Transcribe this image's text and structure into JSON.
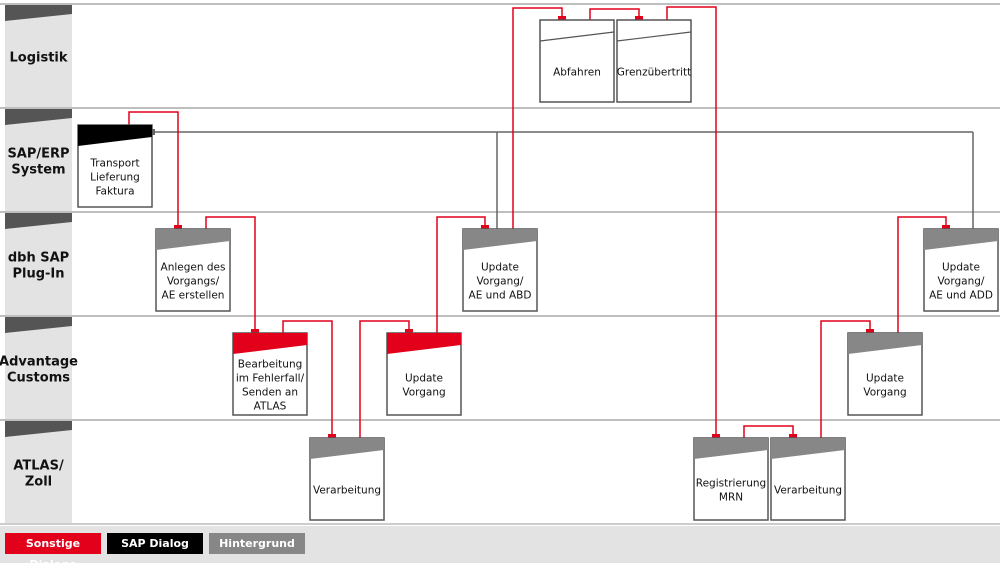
{
  "colors": {
    "red": "#e2001a",
    "black": "#000000",
    "gray": "#878787",
    "lane_bg": "#e3e3e3",
    "lane_strip": "#555555",
    "connector_gray": "#666666"
  },
  "lanes": [
    {
      "label": [
        "Logistik"
      ]
    },
    {
      "label": [
        "SAP/ERP",
        "System"
      ]
    },
    {
      "label": [
        "dbh SAP",
        "Plug-In"
      ]
    },
    {
      "label": [
        "Advantage",
        "Customs"
      ]
    },
    {
      "label": [
        "ATLAS/",
        "Zoll"
      ]
    }
  ],
  "boxes": [
    {
      "id": "abfahren",
      "lane": 0,
      "type": "none",
      "lines": [
        "Abfahren"
      ]
    },
    {
      "id": "grenzuebertritt",
      "lane": 0,
      "type": "none",
      "lines": [
        "Grenzübertritt"
      ]
    },
    {
      "id": "transport",
      "lane": 1,
      "type": "black",
      "lines": [
        "Transport",
        "Lieferung",
        "Faktura"
      ]
    },
    {
      "id": "anlegen",
      "lane": 2,
      "type": "gray",
      "lines": [
        "Anlegen des",
        "Vorgangs/",
        "AE erstellen"
      ]
    },
    {
      "id": "update-abd",
      "lane": 2,
      "type": "gray",
      "lines": [
        "Update",
        "Vorgang/",
        "AE und ABD"
      ]
    },
    {
      "id": "update-add",
      "lane": 2,
      "type": "gray",
      "lines": [
        "Update",
        "Vorgang/",
        "AE und ADD"
      ]
    },
    {
      "id": "bearbeitung",
      "lane": 3,
      "type": "red",
      "lines": [
        "Bearbeitung",
        "im Fehlerfall/",
        "Senden an",
        "ATLAS"
      ]
    },
    {
      "id": "update-red",
      "lane": 3,
      "type": "red",
      "lines": [
        "Update",
        "Vorgang"
      ]
    },
    {
      "id": "update-gray",
      "lane": 3,
      "type": "gray",
      "lines": [
        "Update",
        "Vorgang"
      ]
    },
    {
      "id": "verarbeitung-1",
      "lane": 4,
      "type": "gray",
      "lines": [
        "Verarbeitung"
      ]
    },
    {
      "id": "registrierung",
      "lane": 4,
      "type": "gray",
      "lines": [
        "Registrierung",
        "MRN"
      ]
    },
    {
      "id": "verarbeitung-2",
      "lane": 4,
      "type": "gray",
      "lines": [
        "Verarbeitung"
      ]
    }
  ],
  "flow": [
    [
      "transport",
      "anlegen"
    ],
    [
      "anlegen",
      "bearbeitung"
    ],
    [
      "bearbeitung",
      "verarbeitung-1"
    ],
    [
      "verarbeitung-1",
      "update-red"
    ],
    [
      "update-red",
      "update-abd"
    ],
    [
      "update-abd",
      "abfahren"
    ],
    [
      "abfahren",
      "grenzuebertritt"
    ],
    [
      "grenzuebertritt",
      "registrierung"
    ],
    [
      "registrierung",
      "verarbeitung-2"
    ],
    [
      "verarbeitung-2",
      "update-gray"
    ],
    [
      "update-gray",
      "update-add"
    ]
  ],
  "background_links": [
    [
      "transport",
      "update-abd"
    ],
    [
      "transport",
      "update-add"
    ]
  ],
  "legend": [
    {
      "label": "Sonstige Dialoge",
      "color": "#e2001a"
    },
    {
      "label": "SAP Dialog",
      "color": "#000000"
    },
    {
      "label": "Hintergrund",
      "color": "#878787"
    }
  ]
}
